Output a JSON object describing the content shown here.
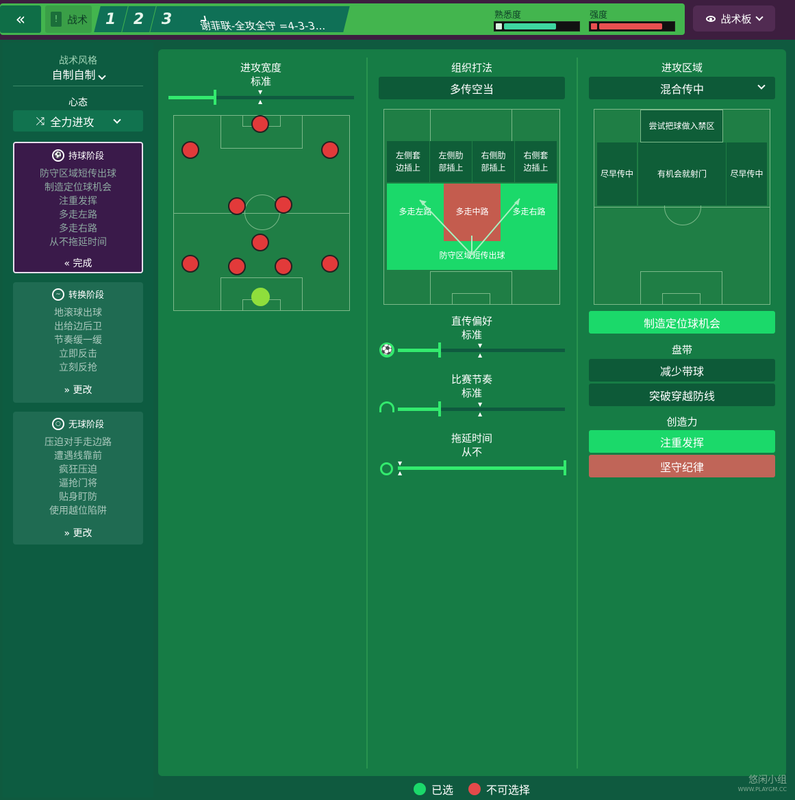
{
  "topbar": {
    "back_icon": "double-chevron-left-icon",
    "tactics_label": "战术",
    "slots": [
      "1",
      "2",
      "3"
    ],
    "formation_name": "谢菲联-全攻全守 =4-3-3...",
    "familiarity_label": "熟悉度",
    "familiarity_level": 0.7,
    "intensity_label": "强度",
    "intensity_level": 0.85,
    "board_label": "战术板"
  },
  "left": {
    "style_title": "战术风格",
    "style_value": "自制自制",
    "mentality_label": "心态",
    "mentality_value": "全力进攻",
    "possession": {
      "title": "持球阶段",
      "items": [
        "防守区域短传出球",
        "制造定位球机会",
        "注重发挥",
        "多走左路",
        "多走右路",
        "从不拖延时间"
      ],
      "button": "完成"
    },
    "transition": {
      "title": "转换阶段",
      "items": [
        "地滚球出球",
        "出给边后卫",
        "节奏缓一缓",
        "立即反击",
        "立刻反抢"
      ],
      "button": "更改"
    },
    "outofpossession": {
      "title": "无球阶段",
      "items": [
        "压迫对手走边路",
        "遭遇线靠前",
        "疯狂压迫",
        "逼抢门将",
        "贴身盯防",
        "使用越位陷阱"
      ],
      "button": "更改"
    }
  },
  "width": {
    "title": "进攻宽度",
    "value": "标准",
    "level": 0.25
  },
  "buildup": {
    "title": "组织打法",
    "value": "多传空当",
    "zones_top": [
      "左侧套边插上",
      "左侧肋部插上",
      "右侧肋部插上",
      "右侧套边插上"
    ],
    "zones_mid": [
      "多走左路",
      "多走中路",
      "多走右路"
    ],
    "zone_bottom": "防守区域短传出球"
  },
  "passing": {
    "title": "直传偏好",
    "value": "标准",
    "level": 0.25
  },
  "tempo": {
    "title": "比赛节奏",
    "value": "标准",
    "level": 0.25
  },
  "timewasting": {
    "title": "拖延时间",
    "value": "从不",
    "level": 1.0
  },
  "attack_zone": {
    "title": "进攻区域",
    "value": "混合传中",
    "zone_top": "尝试把球做入禁区",
    "zone_left": "尽早传中",
    "zone_center": "有机会就射门",
    "zone_right": "尽早传中",
    "setpiece_btn": "制造定位球机会"
  },
  "dribbling": {
    "title": "盘带",
    "options": [
      "减少带球",
      "突破穿越防线"
    ]
  },
  "creativity": {
    "title": "创造力",
    "options": [
      "注重发挥",
      "坚守纪律"
    ]
  },
  "legend": {
    "selected": "已选",
    "unavailable": "不可选择"
  },
  "colors": {
    "selected": "#1bd96a",
    "unavailable": "#e34a4a",
    "accent": "#33ea6e",
    "panel": "#167c45"
  },
  "watermark": {
    "line1": "悠闲小组",
    "line2": "WWW.PLAYGM.CC"
  }
}
